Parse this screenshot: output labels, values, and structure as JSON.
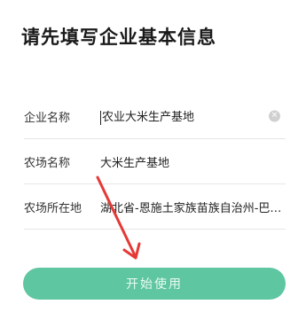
{
  "page": {
    "title": "请先填写企业基本信息"
  },
  "form": {
    "fields": [
      {
        "label": "企业名称",
        "value": "农业大米生产基地",
        "has_clear": true,
        "has_cursor": true
      },
      {
        "label": "农场名称",
        "value": "大米生产基地"
      },
      {
        "label": "农场所在地",
        "value": "湖北省-恩施土家族苗族自治州-巴东…"
      }
    ]
  },
  "actions": {
    "start_label": "开始使用"
  },
  "icons": {
    "clear": "clear-icon",
    "annotation": "red-arrow-icon"
  },
  "colors": {
    "accent": "#5ec6a1",
    "arrow": "#e53935"
  }
}
